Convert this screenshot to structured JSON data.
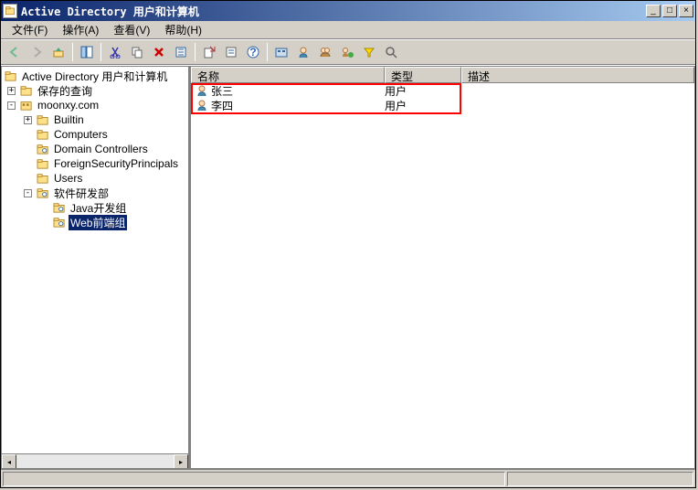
{
  "window": {
    "title": "Active Directory 用户和计算机"
  },
  "menubar": {
    "file": "文件(F)",
    "action": "操作(A)",
    "view": "查看(V)",
    "help": "帮助(H)"
  },
  "tree": {
    "root": "Active Directory 用户和计算机",
    "saved_queries": "保存的查询",
    "domain": "moonxy.com",
    "builtin": "Builtin",
    "computers": "Computers",
    "domain_controllers": "Domain Controllers",
    "fsp": "ForeignSecurityPrincipals",
    "users": "Users",
    "software_dept": "软件研发部",
    "java_group": "Java开发组",
    "web_group": "Web前端组"
  },
  "list": {
    "columns": {
      "name": "名称",
      "type": "类型",
      "desc": "描述"
    },
    "rows": [
      {
        "name": "张三",
        "type": "用户"
      },
      {
        "name": "李四",
        "type": "用户"
      }
    ]
  },
  "toolbar_icons": [
    "back-icon",
    "forward-icon",
    "up-icon",
    "show-hide-tree-icon",
    "cut-icon",
    "copy-icon",
    "delete-icon",
    "refresh-icon",
    "export-icon",
    "properties-icon",
    "help-icon",
    "filter-options-icon",
    "new-user-icon",
    "new-group-icon",
    "add-to-group-icon",
    "filter-icon",
    "find-icon"
  ]
}
